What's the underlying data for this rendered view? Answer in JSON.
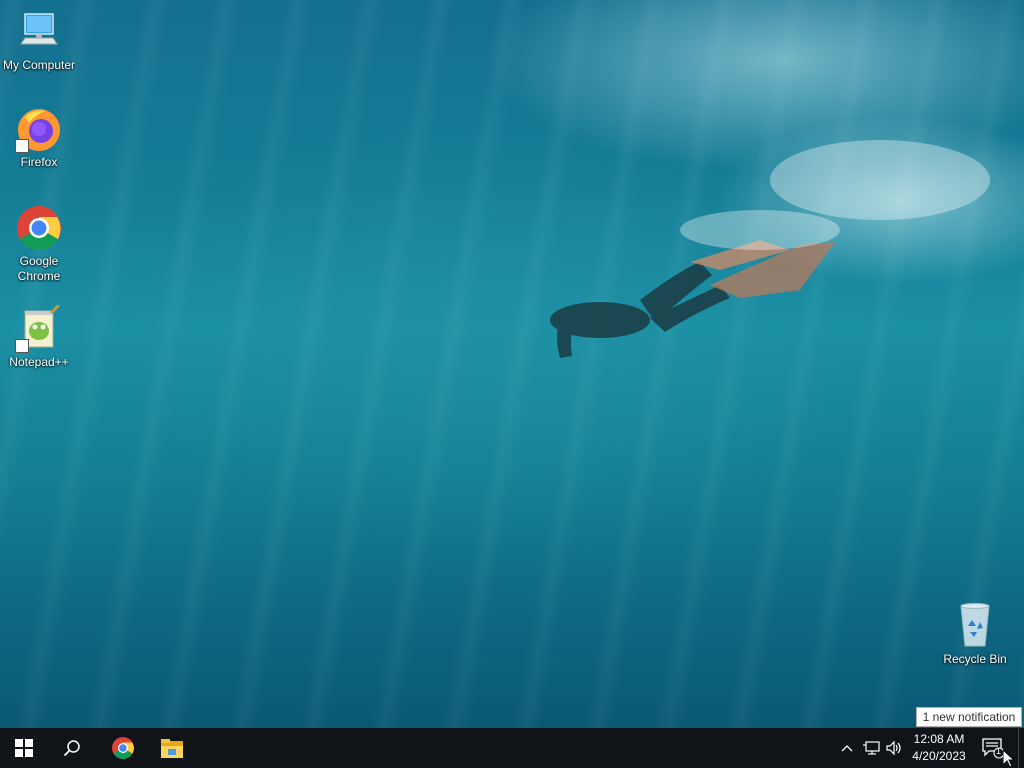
{
  "desktop": {
    "icons": [
      {
        "label": "My Computer",
        "icon": "computer-icon"
      },
      {
        "label": "Firefox",
        "icon": "firefox-icon"
      },
      {
        "label": "Google Chrome",
        "icon": "chrome-icon"
      },
      {
        "label": "Notepad++",
        "icon": "notepadpp-icon"
      },
      {
        "label": "Recycle Bin",
        "icon": "recycle-bin-icon"
      }
    ]
  },
  "taskbar": {
    "start": "windows-logo-icon",
    "search": "search-icon",
    "pinned": [
      "chrome-icon",
      "file-explorer-icon"
    ],
    "tray": {
      "icons": [
        "chevron-up-icon",
        "network-icon",
        "volume-icon"
      ],
      "time": "12:08 AM",
      "date": "4/20/2023",
      "notification_count": "1"
    }
  },
  "toast": {
    "text": "1 new notification"
  },
  "colors": {
    "taskbar": "#101418",
    "water": "#157d96"
  }
}
